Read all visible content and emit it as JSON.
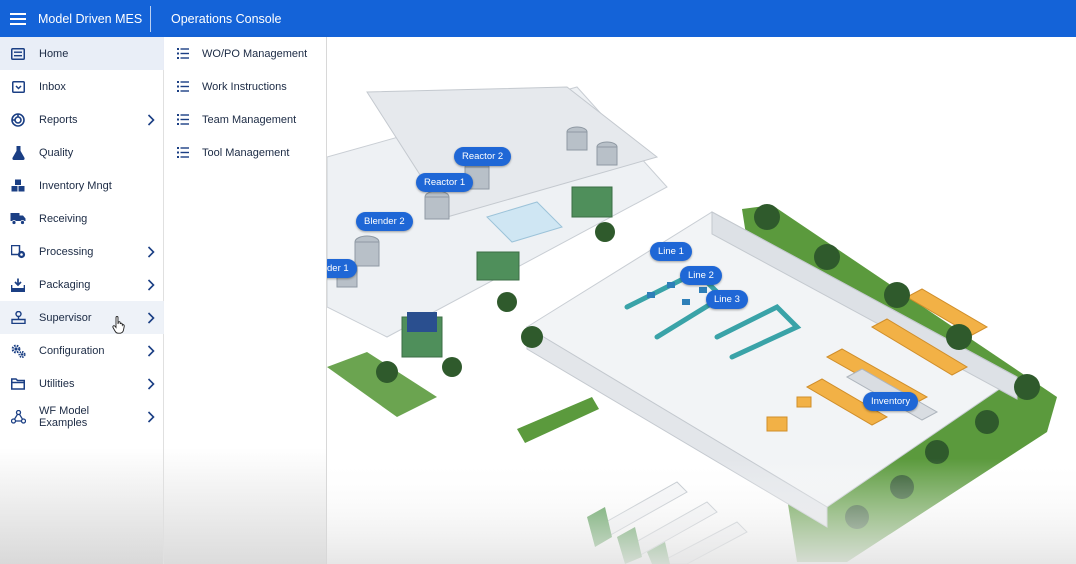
{
  "header": {
    "app_title": "Model Driven MES",
    "console_title": "Operations Console",
    "menu_icon": "hamburger-icon"
  },
  "sidebar": {
    "items": [
      {
        "label": "Home",
        "icon": "list-icon",
        "has_submenu": false
      },
      {
        "label": "Inbox",
        "icon": "inbox-icon",
        "has_submenu": false
      },
      {
        "label": "Reports",
        "icon": "reports-icon",
        "has_submenu": true
      },
      {
        "label": "Quality",
        "icon": "flask-icon",
        "has_submenu": false
      },
      {
        "label": "Inventory Mngt",
        "icon": "boxes-icon",
        "has_submenu": false
      },
      {
        "label": "Receiving",
        "icon": "truck-icon",
        "has_submenu": false
      },
      {
        "label": "Processing",
        "icon": "processing-icon",
        "has_submenu": true
      },
      {
        "label": "Packaging",
        "icon": "package-icon",
        "has_submenu": true
      },
      {
        "label": "Supervisor",
        "icon": "supervisor-icon",
        "has_submenu": true
      },
      {
        "label": "Configuration",
        "icon": "gears-icon",
        "has_submenu": true
      },
      {
        "label": "Utilities",
        "icon": "folder-icon",
        "has_submenu": true
      },
      {
        "label": "WF Model Examples",
        "icon": "workflow-icon",
        "has_submenu": true
      }
    ]
  },
  "submenu": {
    "items": [
      {
        "label": "WO/PO Management",
        "icon": "list-icon"
      },
      {
        "label": "Work Instructions",
        "icon": "list-icon"
      },
      {
        "label": "Team Management",
        "icon": "list-icon"
      },
      {
        "label": "Tool Management",
        "icon": "list-icon"
      }
    ]
  },
  "plant_map": {
    "labels": [
      {
        "text": "Reactor 2"
      },
      {
        "text": "Reactor 1"
      },
      {
        "text": "Blender 2"
      },
      {
        "text": "der 1"
      },
      {
        "text": "Line 1"
      },
      {
        "text": "Line 2"
      },
      {
        "text": "Line 3"
      },
      {
        "text": "Inventory"
      }
    ]
  },
  "colors": {
    "header_bg": "#1463d8",
    "label_bg": "#1f67d6",
    "icon": "#1b3f84",
    "grass": "#5b9a3d"
  }
}
